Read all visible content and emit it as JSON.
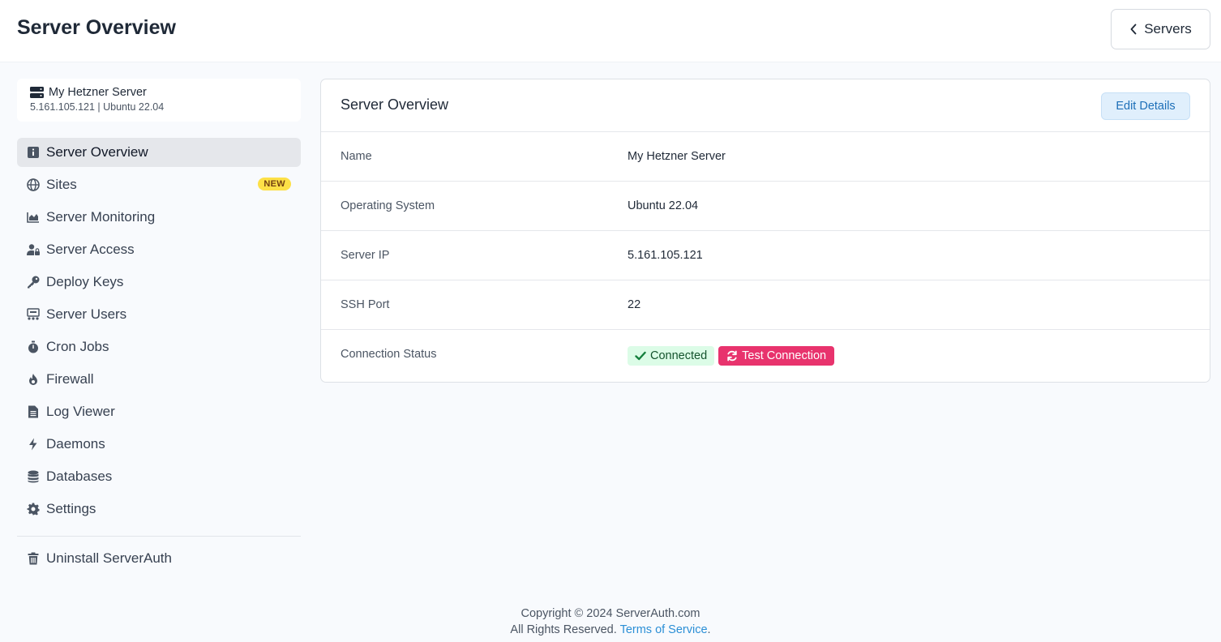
{
  "header": {
    "title": "Server Overview",
    "back_button_label": "Servers"
  },
  "server_card": {
    "name": "My Hetzner Server",
    "meta": "5.161.105.121 | Ubuntu 22.04"
  },
  "sidebar": {
    "items": [
      {
        "label": "Server Overview",
        "icon": "info-icon",
        "active": true
      },
      {
        "label": "Sites",
        "icon": "globe-icon",
        "badge": "NEW"
      },
      {
        "label": "Server Monitoring",
        "icon": "chart-area-icon"
      },
      {
        "label": "Server Access",
        "icon": "user-lock-icon"
      },
      {
        "label": "Deploy Keys",
        "icon": "key-icon"
      },
      {
        "label": "Server Users",
        "icon": "users-network-icon"
      },
      {
        "label": "Cron Jobs",
        "icon": "stopwatch-icon"
      },
      {
        "label": "Firewall",
        "icon": "fire-icon"
      },
      {
        "label": "Log Viewer",
        "icon": "file-icon"
      },
      {
        "label": "Daemons",
        "icon": "bolt-icon"
      },
      {
        "label": "Databases",
        "icon": "database-icon"
      },
      {
        "label": "Settings",
        "icon": "gear-icon"
      }
    ],
    "uninstall": {
      "label": "Uninstall ServerAuth",
      "icon": "trash-icon"
    }
  },
  "panel": {
    "title": "Server Overview",
    "edit_label": "Edit Details",
    "rows": [
      {
        "label": "Name",
        "value": "My Hetzner Server"
      },
      {
        "label": "Operating System",
        "value": "Ubuntu 22.04"
      },
      {
        "label": "Server IP",
        "value": "5.161.105.121"
      },
      {
        "label": "SSH Port",
        "value": "22"
      },
      {
        "label": "Connection Status",
        "status": "Connected",
        "test_label": "Test Connection"
      }
    ]
  },
  "footer": {
    "line1": "Copyright © 2024 ServerAuth.com",
    "line2": "All Rights Reserved.",
    "tos_link": "Terms of Service",
    "tos_suffix": "."
  },
  "colors": {
    "accent_pink": "#e8336d",
    "status_green_bg": "#dcfce7",
    "badge_yellow": "#fde047",
    "link_blue": "#2b8fd6"
  }
}
